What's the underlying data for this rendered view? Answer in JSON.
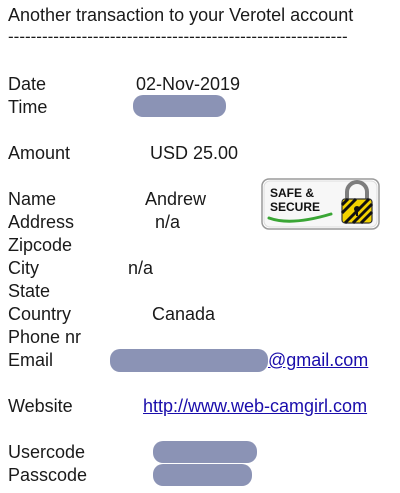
{
  "header": {
    "title": "Another transaction to your Verotel account",
    "divider": "------------------------------------------------------------"
  },
  "labels": {
    "date": "Date",
    "time": "Time",
    "amount": "Amount",
    "name": "Name",
    "address": "Address",
    "zipcode": "Zipcode",
    "city": "City",
    "state": "State",
    "country": "Country",
    "phone": "Phone nr",
    "email": "Email",
    "website": "Website",
    "usercode": "Usercode",
    "passcode": "Passcode"
  },
  "values": {
    "date": "02-Nov-2019",
    "amount": "USD 25.00",
    "name": "Andrew",
    "address": "n/a",
    "city": "n/a",
    "country": "Canada",
    "email_domain": "@gmail.com",
    "website": "http://www.web-camgirl.com"
  },
  "badge": {
    "line1": "SAFE &",
    "line2": "SECURE"
  },
  "colors": {
    "redaction": "#8b93b5",
    "link": "#1a0dab",
    "badge_green": "#3aa635",
    "lock_yellow": "#f2d200"
  }
}
